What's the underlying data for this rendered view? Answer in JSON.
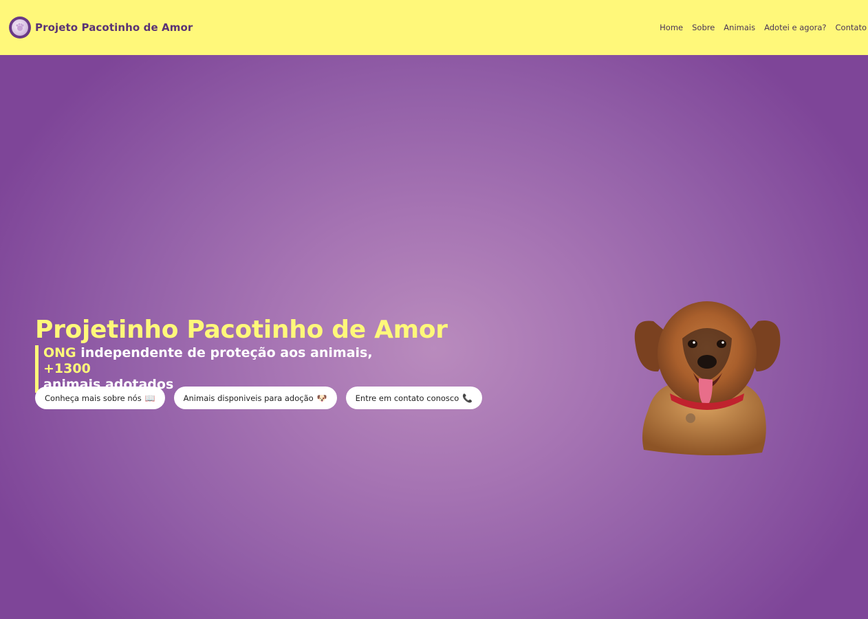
{
  "header": {
    "brand_title": "Projeto Pacotinho de Amor",
    "logo_icon": "paw-heart-logo-icon",
    "nav": [
      {
        "label": "Home"
      },
      {
        "label": "Sobre"
      },
      {
        "label": "Animais"
      },
      {
        "label": "Adotei e agora?"
      },
      {
        "label": "Contato"
      }
    ],
    "background_color": "#fff87a"
  },
  "hero": {
    "title": "Projetinho Pacotinho de Amor",
    "subtitle": {
      "part1": "ONG",
      "part2": " independente de proteção aos animais, ",
      "part3": "+1300",
      "part4": " animais adotados"
    },
    "buttons": [
      {
        "label": "Conheça mais sobre nós",
        "emoji": "📖"
      },
      {
        "label": "Animais disponiveis para adoção",
        "emoji": "🐶"
      },
      {
        "label": "Entre em contato conosco",
        "emoji": "📞"
      }
    ],
    "image_alt": "dog-photo",
    "accent_color": "#fff87a",
    "background_color": "#9a67ad"
  }
}
